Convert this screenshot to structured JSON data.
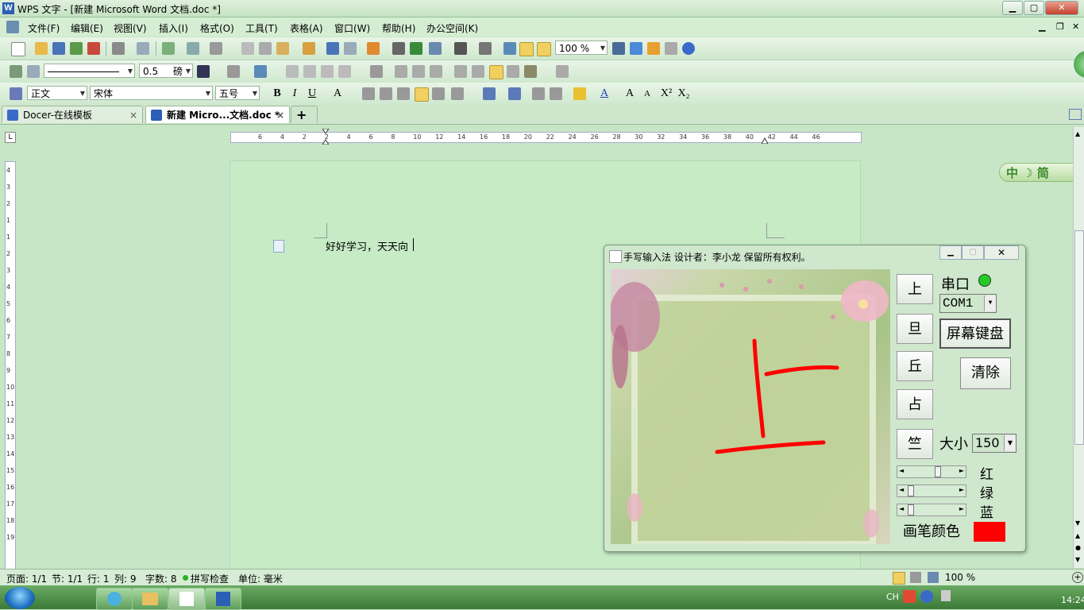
{
  "window": {
    "title": "WPS 文字 - [新建 Microsoft Word 文档.doc *]",
    "app_icon": "W"
  },
  "menu": [
    "文件(F)",
    "编辑(E)",
    "视图(V)",
    "插入(I)",
    "格式(O)",
    "工具(T)",
    "表格(A)",
    "窗口(W)",
    "帮助(H)",
    "办公空间(K)"
  ],
  "toolbar1": {
    "zoom": "100 %"
  },
  "toolbar2": {
    "line_width": "0.5",
    "line_unit": "磅"
  },
  "toolbar3": {
    "style": "正文",
    "font": "宋体",
    "size": "五号",
    "bold": "B",
    "italic": "I",
    "underline": "U"
  },
  "tabs": [
    {
      "label": "Docer-在线模板",
      "close": "×"
    },
    {
      "label": "新建 Micro...文档.doc *",
      "close": "×"
    }
  ],
  "tab_add": "+",
  "ruler_numbers": [
    "6",
    "4",
    "2",
    "2",
    "4",
    "6",
    "8",
    "10",
    "12",
    "14",
    "16",
    "18",
    "20",
    "22",
    "24",
    "26",
    "28",
    "30",
    "32",
    "34",
    "36",
    "38",
    "40",
    "42",
    "44",
    "46"
  ],
  "ruler_v_numbers": [
    "4",
    "3",
    "2",
    "1",
    "1",
    "2",
    "3",
    "4",
    "5",
    "6",
    "7",
    "8",
    "9",
    "10",
    "11",
    "12",
    "13",
    "14",
    "15",
    "16",
    "17",
    "18",
    "19"
  ],
  "document": {
    "text": "好好学习，天天向"
  },
  "ime_badge": {
    "text": "中 ☽ 简"
  },
  "status": {
    "page": "页面: 1/1",
    "section": "节: 1/1",
    "row": "行: 1",
    "col": "列: 9",
    "words": "字数: 8",
    "spell": "拼写检查",
    "unit": "单位: 毫米",
    "zoom": "100 %"
  },
  "taskbar": {
    "lang": "CH",
    "clock": "14:24"
  },
  "handwriting": {
    "title": "手写输入法  设计者：李小龙  保留所有权利。",
    "candidates": [
      "上",
      "旦",
      "丘",
      "占",
      "竺"
    ],
    "serial_label": "串口",
    "serial_status_color": "#22cc22",
    "com_port": "COM1",
    "keyboard_btn": "屏幕键盘",
    "clear_btn": "清除",
    "size_label": "大小",
    "size_value": "150",
    "color_labels": [
      "红",
      "绿",
      "蓝"
    ],
    "color_levels": [
      0.6,
      0.05,
      0.05
    ],
    "pen_color_label": "画笔颜色",
    "pen_color": "#ff0000"
  }
}
